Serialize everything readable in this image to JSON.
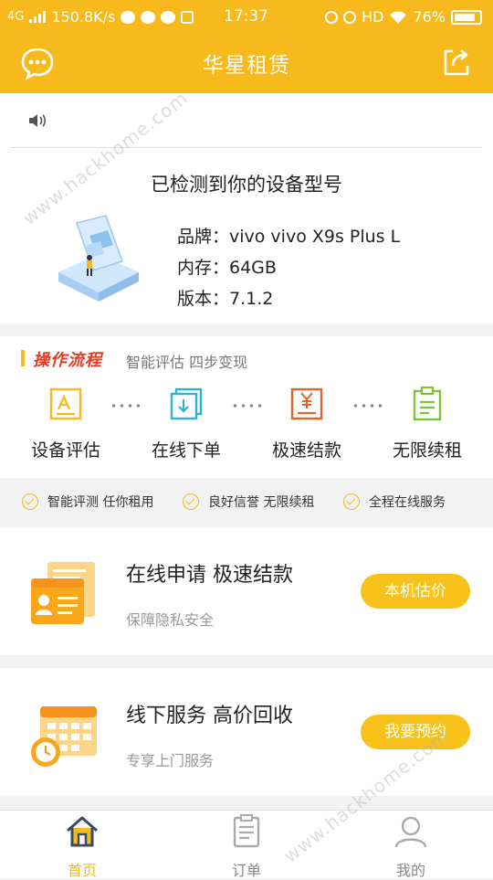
{
  "status_bar": {
    "network": "4G",
    "speed": "150.8K/s",
    "time": "17:37",
    "hd": "HD",
    "battery": "76%"
  },
  "header": {
    "title": "华星租赁",
    "chat_icon": "chat-bubble-icon",
    "share_icon": "share-icon"
  },
  "notice": {
    "speaker_icon": "speaker-icon"
  },
  "device": {
    "title": "已检测到你的设备型号",
    "brand": "品牌：vivo vivo X9s Plus L",
    "memory": "内存：64GB",
    "version": "版本：7.1.2"
  },
  "process": {
    "title": "操作流程",
    "subtitle": "智能评估   四步变现",
    "steps": [
      {
        "label": "设备评估",
        "icon": "evaluate-icon",
        "color": "#f7b91b"
      },
      {
        "label": "在线下单",
        "icon": "download-order-icon",
        "color": "#2bb3d8"
      },
      {
        "label": "极速结款",
        "icon": "yen-receipt-icon",
        "color": "#e8632a"
      },
      {
        "label": "无限续租",
        "icon": "clipboard-icon",
        "color": "#7ec23a"
      }
    ]
  },
  "features": [
    "智能评测  任你租用",
    "良好信誉  无限续租",
    "全程在线服务"
  ],
  "cards": [
    {
      "title": "在线申请  极速结款",
      "subtitle": "保障隐私安全",
      "button": "本机估价"
    },
    {
      "title": "线下服务  高价回收",
      "subtitle": "专享上门服务",
      "button": "我要预约"
    }
  ],
  "tabs": [
    {
      "label": "首页",
      "icon": "home-icon",
      "active": true
    },
    {
      "label": "订单",
      "icon": "order-icon",
      "active": false
    },
    {
      "label": "我的",
      "icon": "profile-icon",
      "active": false
    }
  ],
  "watermark": "www.hackhome.com",
  "colors": {
    "accent": "#f7b91b",
    "button": "#f8c21a",
    "process_title": "#e53b1f"
  }
}
